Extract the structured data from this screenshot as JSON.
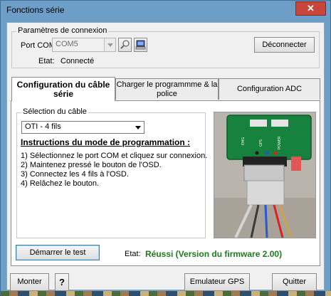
{
  "window": {
    "title": "Fonctions série",
    "close_glyph": "✕"
  },
  "connection": {
    "group_label": "Paramètres de connexion",
    "port_label": "Port COM:",
    "port_value": "COM5",
    "state_label": "Etat:",
    "state_value": "Connecté",
    "disconnect_label": "Déconnecter",
    "icons": [
      "search-icon",
      "computer-icon"
    ]
  },
  "tabs": [
    {
      "label": "Configuration du câble série",
      "active": true
    },
    {
      "label": "Charger le programmme & la police",
      "active": false
    },
    {
      "label": "Configuration ADC",
      "active": false
    }
  ],
  "cable": {
    "group_label": "Sélection du câble",
    "selected": "OTI - 4 fils",
    "instructions_title": "Instructions du mode de programmation :",
    "steps": [
      "1) Sélectionnez le port COM et cliquez sur connexion.",
      "2) Maintenez pressé le bouton de l'OSD.",
      "3) Connectez les 4 fils à l'OSD.",
      "4) Relâchez le bouton."
    ],
    "photo_labels": [
      "EMG",
      "GPS",
      "POWER"
    ]
  },
  "test": {
    "start_label": "Démarrer le test",
    "state_label": "Etat:",
    "result": "Réussi (Version du firmware 2.00)",
    "result_color": "#1f7a1f"
  },
  "footer": {
    "monter_label": "Monter",
    "help_label": "?",
    "gps_label": "Emulateur GPS",
    "quit_label": "Quitter"
  }
}
